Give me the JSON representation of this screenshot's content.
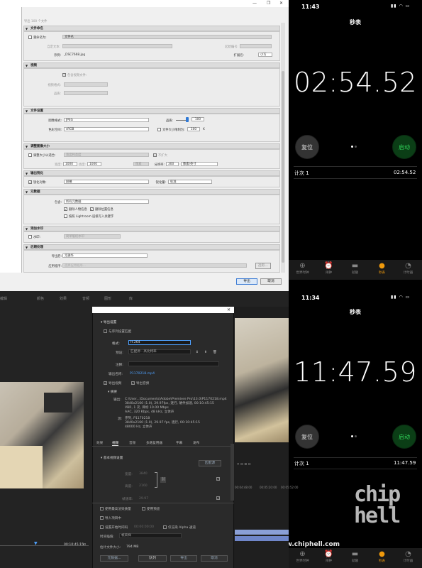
{
  "lightroom": {
    "top_text": "导出 100 个文件",
    "sections": {
      "file_naming": {
        "header": "文件命名",
        "rename_label": "重命名为:",
        "rename_value": "文件名",
        "custom_text_label": "自定文本:",
        "start_number_label": "起始编号:",
        "example_label": "示例:",
        "example_value": "_DSC7668.jpg",
        "extension_label": "扩展名:",
        "extension_value": "小写"
      },
      "video": {
        "header": "视频",
        "include_label": "包含视频文件:",
        "format_label": "视频格式:",
        "quality_label": "品质:"
      },
      "file_settings": {
        "header": "文件设置",
        "format_label": "图像格式:",
        "format_value": "JPEG",
        "quality_label": "品质:",
        "quality_value": "100",
        "color_label": "色彩空间:",
        "color_value": "sRGB",
        "limit_label": "文件大小限制为:",
        "limit_value": "100",
        "limit_unit": "K"
      },
      "image_sizing": {
        "header": "调整图像大小",
        "resize_label": "调整大小以适合:",
        "resize_value": "宽度和高度",
        "no_enlarge": "不扩大",
        "w_label": "宽度:",
        "w_value": "1000",
        "h_label": "高度:",
        "h_value": "1000",
        "unit_value": "像素",
        "res_label": "分辨率:",
        "res_value": "300",
        "res_unit": "像素/英寸"
      },
      "sharpening": {
        "header": "输出锐化",
        "sharpen_label": "锐化对象:",
        "sharpen_value": "屏幕",
        "amount_label": "锐化量:",
        "amount_value": "标准"
      },
      "metadata": {
        "header": "元数据",
        "include_label": "包含:",
        "include_value": "所有元数据",
        "opt1": "删除人物信息",
        "opt2": "删除位置信息",
        "opt3": "按照 Lightroom 层级写入关键字"
      },
      "watermark": {
        "header": "添加水印",
        "wm_label": "水印:",
        "wm_value": "简单版权水印"
      },
      "post": {
        "header": "后期处理",
        "after_label": "导出后:",
        "after_value": "无操作",
        "app_label": "应用程序:",
        "app_value": "选择应用程序...",
        "choose_btn": "选取..."
      }
    },
    "export_btn": "导出",
    "cancel_btn": "取消"
  },
  "phone_top": {
    "time": "11:43",
    "title": "秒表",
    "timer": "02:54.52",
    "reset": "复位",
    "start": "启动",
    "lap_label": "计次 1",
    "lap_time": "02:54.52"
  },
  "phone_bottom": {
    "time": "11:34",
    "title": "秒表",
    "timer": "11:47.59",
    "reset": "复位",
    "start": "启动",
    "lap_label": "计次 1",
    "lap_time": "11:47.59"
  },
  "tabs": [
    "世界时钟",
    "闹钟",
    "就寝",
    "秒表",
    "计时器"
  ],
  "premiere": {
    "menu": [
      "编辑",
      "颜色",
      "效果",
      "音频",
      "图形",
      "库"
    ],
    "section_title": "导出设置",
    "match_seq": "与序列设置匹配",
    "format_label": "格式:",
    "format_value": "H.264",
    "preset_label": "预设:",
    "preset_value": "匹配源 - 高比特率",
    "comment_label": "注释:",
    "output_label": "输出名称:",
    "output_value": "P1170218.mp4",
    "export_video": "导出视频",
    "export_audio": "导出音频",
    "summary_title": "摘要",
    "summary_out_label": "输出:",
    "summary_out": [
      "C:\\User...\\Documents\\Adobe\\Premiere Pro\\13.0\\P1170218.mp4",
      "3840x2160 (1.0), 29.97fps, 逐行, 硬件加速, 00:10:45:15",
      "VBR, 1 次, 目标 10.00 Mbps",
      "AAC, 320 Kbps, 48 kHz, 立体声"
    ],
    "summary_src_label": "源:",
    "summary_src": [
      "序列, P1170218",
      "3840x2160 (1.0), 29.97 fps, 逐行, 00:10:45:15",
      "48000 Hz, 立体声"
    ],
    "tabs": [
      "效果",
      "视频",
      "音频",
      "多路复用器",
      "字幕",
      "发布"
    ],
    "basic_video": "基本视频设置",
    "match_source_btn": "匹配源",
    "width_label": "宽度:",
    "width_value": "3840",
    "height_label": "高度:",
    "height_value": "2160",
    "fps_label": "帧速率:",
    "fps_value": "29.97",
    "max_render": "使用最高渲染质量",
    "use_preview": "使用预览",
    "import_project": "导入项目中",
    "set_start": "设置开始时间码",
    "start_tc": "00:00:00:00",
    "render_alpha": "仅渲染 Alpha 通道",
    "interp_label": "时间插值:",
    "interp_value": "帧采样",
    "file_size_label": "估计文件大小:",
    "file_size_value": "794 MB",
    "btn_metadata": "元数据...",
    "btn_queue": "队列",
    "btn_export": "导出",
    "btn_cancel": "取消",
    "timecode": "00:10:45:15",
    "timeline_ticks": [
      "00:04:48:00",
      "00:05:20:00",
      "00:05:52:00"
    ]
  },
  "watermark": {
    "site": "www.chiphell.com",
    "logo": "chip hell"
  }
}
